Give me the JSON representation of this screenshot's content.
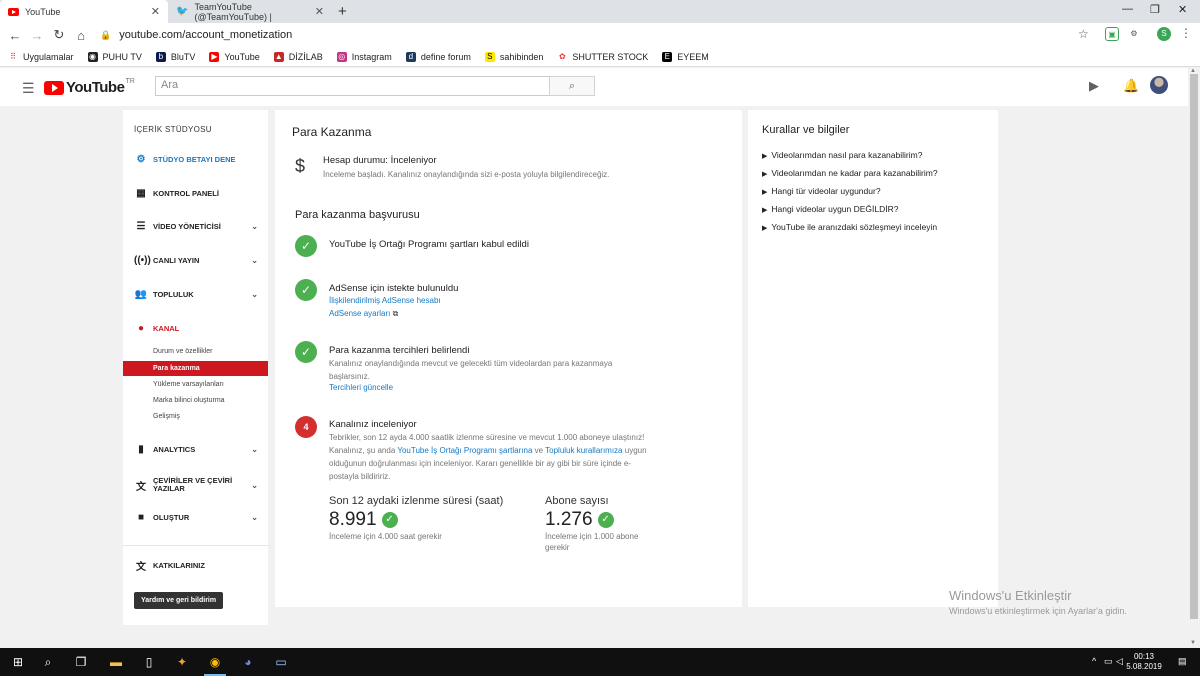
{
  "browser": {
    "tabs": [
      {
        "title": "YouTube",
        "icon": "youtube-favicon"
      },
      {
        "title": "TeamYouTube (@TeamYouTube) |",
        "icon": "twitter-favicon"
      }
    ],
    "url": "youtube.com/account_monetization",
    "bookmarks": [
      {
        "label": "Uygulamalar",
        "icon": "apps-grid-icon"
      },
      {
        "label": "PUHU TV",
        "icon": "puhutv-icon"
      },
      {
        "label": "BluTV",
        "icon": "blutv-icon"
      },
      {
        "label": "YouTube",
        "icon": "youtube-icon"
      },
      {
        "label": "DİZİLAB",
        "icon": "dizilab-icon"
      },
      {
        "label": "Instagram",
        "icon": "instagram-icon"
      },
      {
        "label": "define forum",
        "icon": "define-icon"
      },
      {
        "label": "sahibinden",
        "icon": "sahibinden-icon"
      },
      {
        "label": "SHUTTER STOCK",
        "icon": "shutterstock-icon"
      },
      {
        "label": "EYEEM",
        "icon": "eyeem-icon"
      }
    ],
    "profile_initial": "S"
  },
  "youtube": {
    "logo_word": "YouTube",
    "logo_region": "TR",
    "search_placeholder": "Ara"
  },
  "sidebar": {
    "title": "İÇERİK STÜDYOSU",
    "items": [
      {
        "label": "STÜDYO BETAYI DENE",
        "icon": "gear-icon"
      },
      {
        "label": "KONTROL PANELİ",
        "icon": "dashboard-icon"
      },
      {
        "label": "VİDEO YÖNETİCİSİ",
        "icon": "video-manager-icon"
      },
      {
        "label": "CANLI YAYIN",
        "icon": "live-icon"
      },
      {
        "label": "TOPLULUK",
        "icon": "community-icon"
      },
      {
        "label": "KANAL",
        "icon": "channel-icon"
      },
      {
        "label": "ANALYTICS",
        "icon": "analytics-icon"
      },
      {
        "label": "ÇEVİRİLER VE ÇEVİRİ YAZILAR",
        "icon": "translate-icon"
      },
      {
        "label": "OLUŞTUR",
        "icon": "create-icon"
      },
      {
        "label": "KATKILARINIZ",
        "icon": "contributions-icon"
      }
    ],
    "channel_sub": [
      "Durum ve özellikler",
      "Para kazanma",
      "Yükleme varsayılanları",
      "Marka bilinci oluşturma",
      "Gelişmiş"
    ],
    "help_button": "Yardım ve geri bildirim"
  },
  "main": {
    "title": "Para Kazanma",
    "account_status": "Hesap durumu: İnceleniyor",
    "account_desc": "İnceleme başladı. Kanalınız onaylandığında sizi e-posta yoluyla bilgilendireceğiz.",
    "application_title": "Para kazanma başvurusu",
    "step1": {
      "title": "YouTube İş Ortağı Programı şartları kabul edildi"
    },
    "step2": {
      "title": "AdSense için istekte bulunuldu",
      "link1": "İlişkilendirilmiş AdSense hesabı",
      "link2": "AdSense ayarları"
    },
    "step3": {
      "title": "Para kazanma tercihleri belirlendi",
      "desc": "Kanalınız onaylandığında mevcut ve gelecekti tüm videolardan para kazanmaya başlarsınız.",
      "link": "Tercihleri güncelle"
    },
    "step4": {
      "number": "4",
      "title": "Kanalınız inceleniyor",
      "desc_a": "Tebrikler, son 12 ayda 4.000 saatlik izlenme süresine ve mevcut 1.000 aboneye ulaştınız! Kanalınız, şu anda ",
      "desc_link1": "YouTube İş Ortağı Programı şartlarına",
      "desc_b": " ve ",
      "desc_link2": "Topluluk kurallarımıza",
      "desc_c": " uygun olduğunun doğrulanması için inceleniyor. Kararı genellikle bir ay gibi bir süre içinde e-postayla bildiririz."
    },
    "stats": {
      "watch_label": "Son 12 aydaki izlenme süresi (saat)",
      "watch_value": "8.991",
      "watch_note": "İnceleme için 4.000 saat gerekir",
      "subs_label": "Abone sayısı",
      "subs_value": "1.276",
      "subs_note": "İnceleme için 1.000 abone gerekir"
    }
  },
  "rules": {
    "title": "Kurallar ve bilgiler",
    "items": [
      "Videolarımdan nasıl para kazanabilirim?",
      "Videolarımdan ne kadar para kazanabilirim?",
      "Hangi tür videolar uygundur?",
      "Hangi videolar uygun DEĞİLDİR?",
      "YouTube ile aranızdaki sözleşmeyi inceleyin"
    ]
  },
  "watermark": {
    "line1": "Windows'u Etkinleştir",
    "line2": "Windows'u etkinleştirmek için Ayarlar'a gidin."
  },
  "taskbar": {
    "time": "00:13",
    "date": "5.08.2019"
  },
  "colors": {
    "youtube_red": "#ff0000",
    "studio_red": "#cc181e",
    "link_blue": "#167ac6",
    "success_green": "#4caf50"
  }
}
